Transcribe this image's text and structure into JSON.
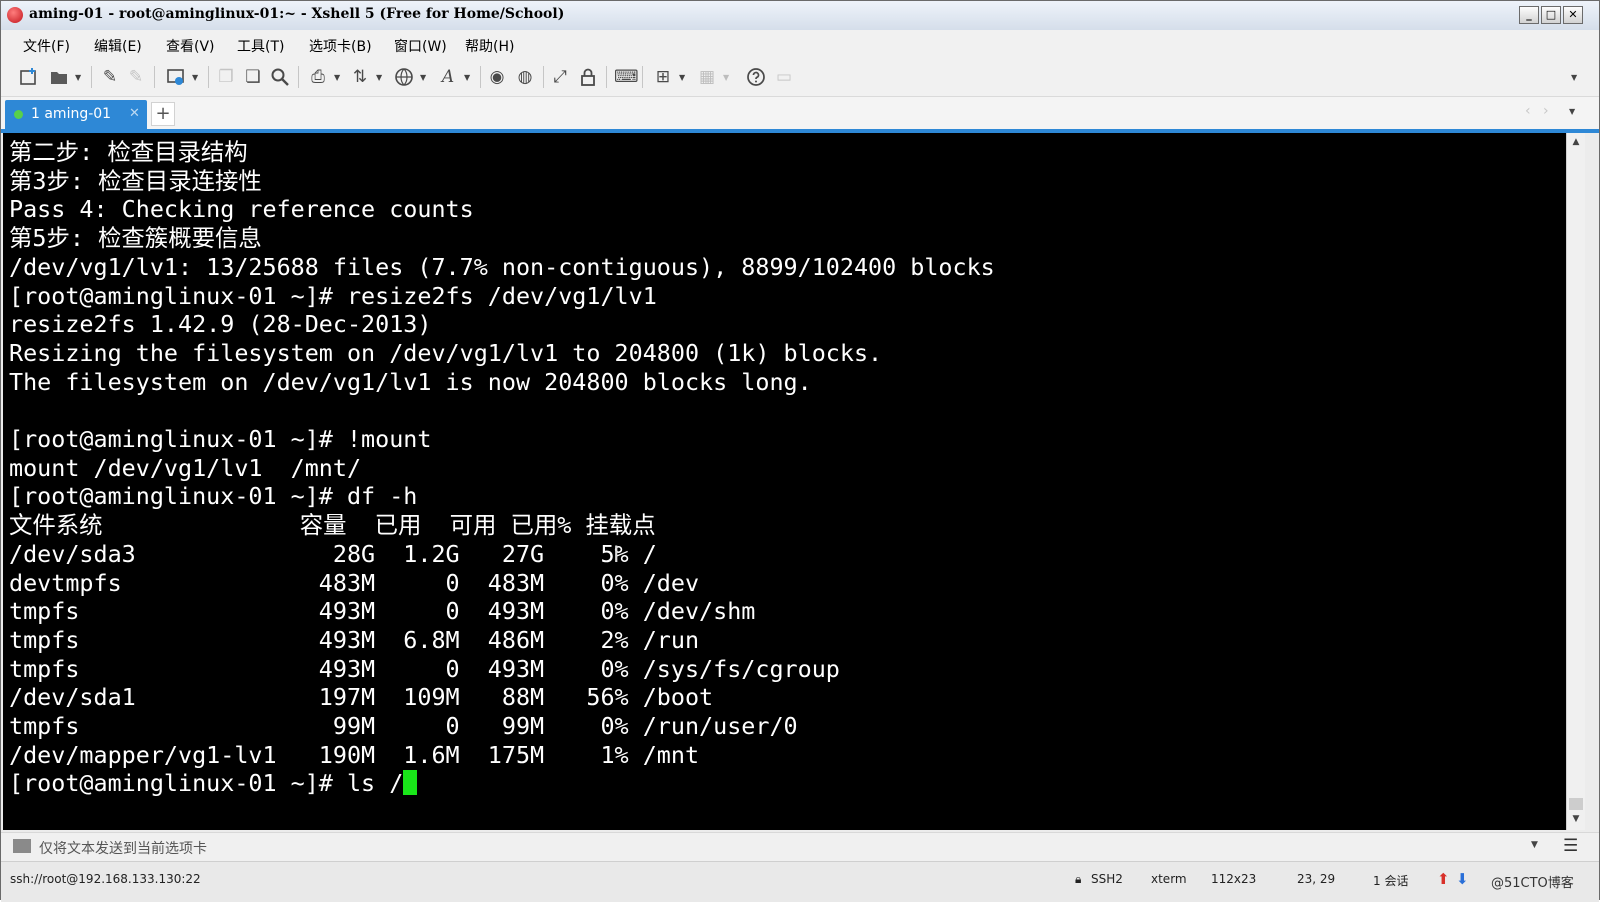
{
  "window": {
    "title": "aming-01 - root@aminglinux-01:~ - Xshell 5 (Free for Home/School)",
    "buttons": {
      "minimize": "_",
      "maximize": "□",
      "close": "✕"
    }
  },
  "menu": {
    "file": "文件(F)",
    "edit": "编辑(E)",
    "view": "查看(V)",
    "tools": "工具(T)",
    "tab": "选项卡(B)",
    "window": "窗口(W)",
    "help": "帮助(H)"
  },
  "toolbar_icons": [
    "new-session-icon",
    "open-folder-icon",
    "pen-icon",
    "pen-disabled-icon",
    "properties-icon",
    "copy-icon",
    "paste-icon",
    "find-icon",
    "print-icon",
    "transfer-icon",
    "globe-icon",
    "font-icon",
    "xftp-icon",
    "xmanager-icon",
    "fullscreen-icon",
    "lock-icon",
    "keyboard-icon",
    "add-icon",
    "layout-icon",
    "help-icon",
    "chat-icon"
  ],
  "tabs": [
    {
      "label": "1 aming-01",
      "active": true
    }
  ],
  "tab_add_label": "+",
  "terminal": {
    "lines": [
      "第二步: 检查目录结构",
      "第3步: 检查目录连接性",
      "Pass 4: Checking reference counts",
      "第5步: 检查簇概要信息",
      "/dev/vg1/lv1: 13/25688 files (7.7% non-contiguous), 8899/102400 blocks",
      "[root@aminglinux-01 ~]# resize2fs /dev/vg1/lv1",
      "resize2fs 1.42.9 (28-Dec-2013)",
      "Resizing the filesystem on /dev/vg1/lv1 to 204800 (1k) blocks.",
      "The filesystem on /dev/vg1/lv1 is now 204800 blocks long.",
      "",
      "[root@aminglinux-01 ~]# !mount",
      "mount /dev/vg1/lv1  /mnt/",
      "[root@aminglinux-01 ~]# df -h",
      "文件系统              容量  已用  可用 已用% 挂载点",
      "/dev/sda3              28G  1.2G   27G    5% /",
      "devtmpfs              483M     0  483M    0% /dev",
      "tmpfs                 493M     0  493M    0% /dev/shm",
      "tmpfs                 493M  6.8M  486M    2% /run",
      "tmpfs                 493M     0  493M    0% /sys/fs/cgroup",
      "/dev/sda1             197M  109M   88M   56% /boot",
      "tmpfs                  99M     0   99M    0% /run/user/0",
      "/dev/mapper/vg1-lv1   190M  1.6M  175M    1% /mnt"
    ],
    "prompt": "[root@aminglinux-01 ~]# ls /",
    "cursor_color": "#19e619",
    "background": "#000000",
    "foreground": "#ffffff"
  },
  "compose": {
    "text": "仅将文本发送到当前选项卡"
  },
  "status": {
    "connection": "ssh://root@192.168.133.130:22",
    "protocol": "SSH2",
    "term": "xterm",
    "size": "112x23",
    "cursor_pos": "23, 29",
    "sessions": "1 会话",
    "watermark": "@51CTO博客"
  },
  "colors": {
    "accent": "#2e88d6",
    "tab_dot": "#58d04a"
  }
}
